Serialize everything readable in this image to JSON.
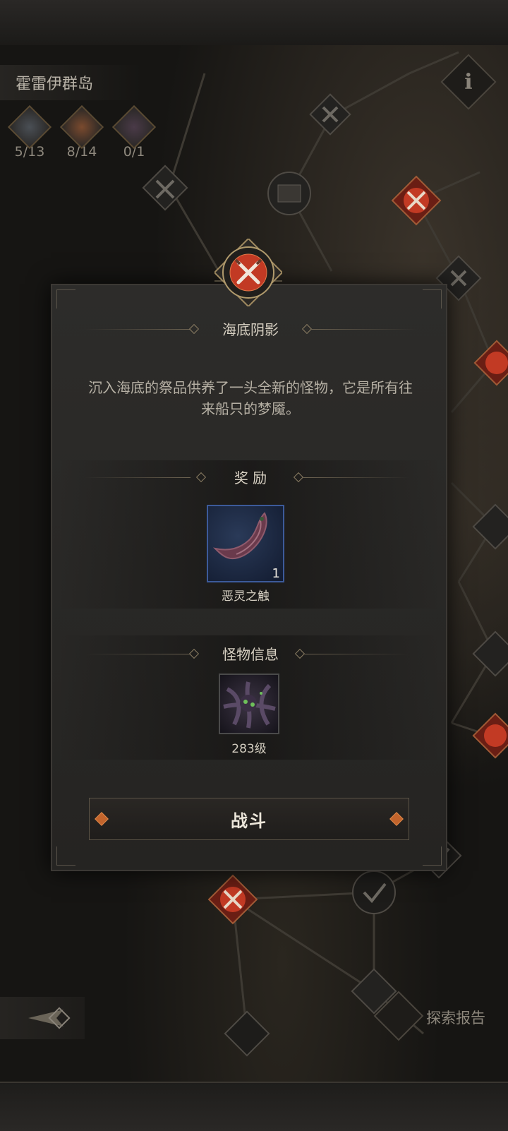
{
  "header": {
    "region_name": "霍雷伊群岛",
    "info_label": "i"
  },
  "chests": [
    {
      "count": "5/13",
      "icon": "iron-chest-icon",
      "color": "#4a4f55"
    },
    {
      "count": "8/14",
      "icon": "bronze-chest-icon",
      "color": "#7a4a2e"
    },
    {
      "count": "0/1",
      "icon": "ornate-chest-icon",
      "color": "#4a3a48"
    }
  ],
  "modal": {
    "title": "海底阴影",
    "description": "沉入海底的祭品供养了一头全新的怪物，它是所有往来船只的梦魇。",
    "reward_section_label": "奖 励",
    "reward_item": {
      "name": "恶灵之触",
      "quantity": "1",
      "icon": "tentacle-icon"
    },
    "monster_section_label": "怪物信息",
    "monster": {
      "level": "283级",
      "icon": "tentacle-monster-icon"
    },
    "fight_label": "战斗"
  },
  "footer": {
    "back_icon": "back-arrow-icon",
    "report_label": "探索报告",
    "report_icon": "scroll-icon"
  },
  "colors": {
    "accent_red": "#c23a24",
    "gold_trim": "#8a7d63",
    "rare_blue": "#3c5a9a"
  }
}
